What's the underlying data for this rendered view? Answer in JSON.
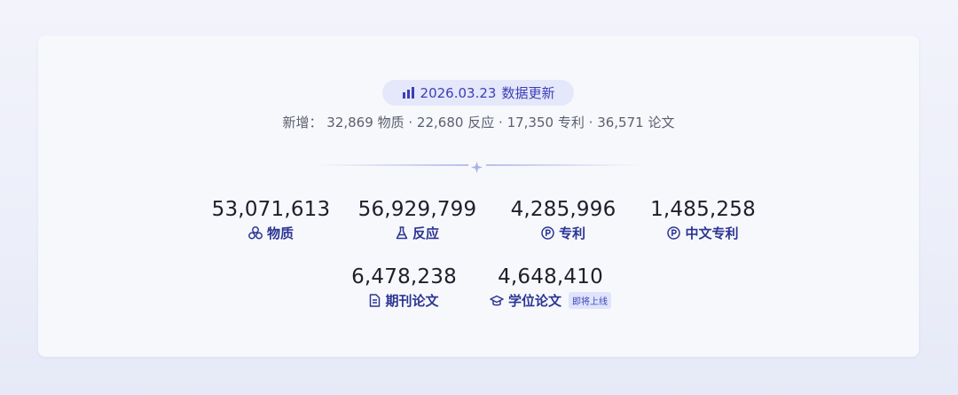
{
  "update_badge": {
    "icon": "bar-chart-icon",
    "date": "2026.03.23",
    "label": "数据更新"
  },
  "summary": {
    "prefix": "新增：",
    "items": [
      {
        "value": "32,869",
        "label": "物质"
      },
      {
        "value": "22,680",
        "label": "反应"
      },
      {
        "value": "17,350",
        "label": "专利"
      },
      {
        "value": "36,571",
        "label": "论文"
      }
    ],
    "separator": "·"
  },
  "stats": [
    {
      "value": "53,071,613",
      "label": "物质",
      "icon": "molecule-icon"
    },
    {
      "value": "56,929,799",
      "label": "反应",
      "icon": "flask-icon"
    },
    {
      "value": "4,285,996",
      "label": "专利",
      "icon": "patent-icon"
    },
    {
      "value": "1,485,258",
      "label": "中文专利",
      "icon": "patent-icon"
    },
    {
      "value": "6,478,238",
      "label": "期刊论文",
      "icon": "document-icon"
    },
    {
      "value": "4,648,410",
      "label": "学位论文",
      "icon": "graduation-cap-icon",
      "tag": "即将上线"
    }
  ],
  "colors": {
    "accent": "#3b3fb4",
    "label": "#2b3592",
    "value": "#1d1f2b",
    "badge_bg": "#e5e7fb"
  }
}
